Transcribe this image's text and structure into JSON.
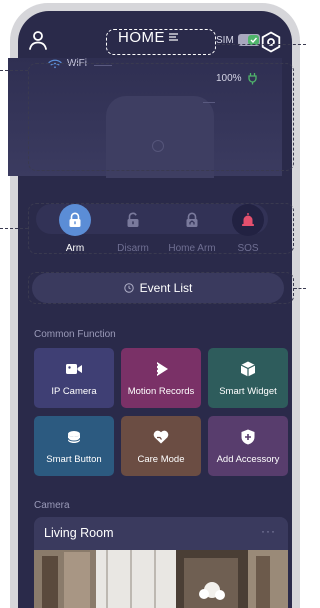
{
  "header": {
    "title": "HOME",
    "title_menu_icon": "menu-lines-icon",
    "left_icon": "person-icon",
    "right_icon": "hexagon-settings-icon"
  },
  "device": {
    "wifi_label": "WiFi",
    "sim_label": "SIM",
    "sim_toggle_on": true,
    "battery_label": "100%",
    "battery_icon": "battery-plug-icon"
  },
  "modes": [
    {
      "label": "Arm",
      "active": true,
      "icon": "lock-closed-icon"
    },
    {
      "label": "Disarm",
      "active": false,
      "icon": "lock-open-icon"
    },
    {
      "label": "Home Arm",
      "active": false,
      "icon": "lock-home-icon"
    },
    {
      "label": "SOS",
      "active": false,
      "icon": "alarm-bell-icon"
    }
  ],
  "event_list": {
    "label": "Event List",
    "icon": "clock-icon"
  },
  "common_function": {
    "title": "Common Function",
    "tiles": [
      {
        "label": "IP Camera",
        "icon": "video-camera-icon",
        "color": "#3f3f74"
      },
      {
        "label": "Motion Records",
        "icon": "motion-play-icon",
        "color": "#7a3167"
      },
      {
        "label": "Smart Widget",
        "icon": "cube-icon",
        "color": "#2e5c5c"
      },
      {
        "label": "Smart Button",
        "icon": "smart-button-icon",
        "color": "#2c5a80"
      },
      {
        "label": "Care Mode",
        "icon": "heart-hand-icon",
        "color": "#6b4d43"
      },
      {
        "label": "Add Accessory",
        "icon": "shield-plus-icon",
        "color": "#583d6d"
      }
    ]
  },
  "camera": {
    "title": "Camera",
    "card_title": "Living Room",
    "more_label": "···"
  },
  "colors": {
    "background": "#2a2a4a",
    "arm_active": "#5b8dd6",
    "sos": "#e4506e",
    "sim_toggle": "#4fb46b",
    "battery": "#4fb46b"
  }
}
